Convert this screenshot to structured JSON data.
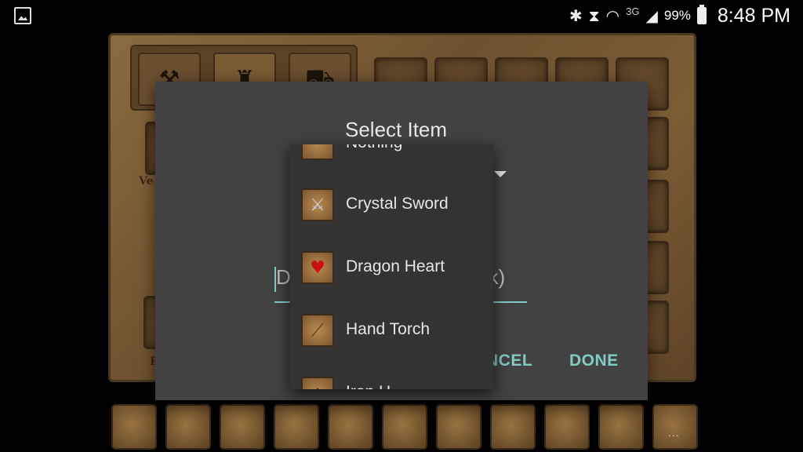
{
  "statusbar": {
    "battery": "99%",
    "time": "8:48 PM",
    "network": "3G",
    "icons": [
      "gallery-icon",
      "bluetooth-icon",
      "vibrate-mute-icon",
      "wifi-icon",
      "signal-icon",
      "battery-icon"
    ]
  },
  "game": {
    "tabs": [
      "saw-icon",
      "helmet-icon",
      "cart-icon"
    ],
    "side_labels": [
      "Ve",
      "P"
    ],
    "more_label": "..."
  },
  "dialog": {
    "title": "Select Item",
    "input_partial_left": "D",
    "input_partial_right": "nk)",
    "cancel_label": "NCEL",
    "done_label": "DONE"
  },
  "dropdown": {
    "items": [
      {
        "label": "Nothing",
        "icon": "empty-slot-icon"
      },
      {
        "label": "Crystal Sword",
        "icon": "sword-icon"
      },
      {
        "label": "Dragon Heart",
        "icon": "heart-icon"
      },
      {
        "label": "Hand Torch",
        "icon": "torch-icon"
      },
      {
        "label": "Iron H",
        "icon": "helmet-item-icon"
      }
    ]
  }
}
